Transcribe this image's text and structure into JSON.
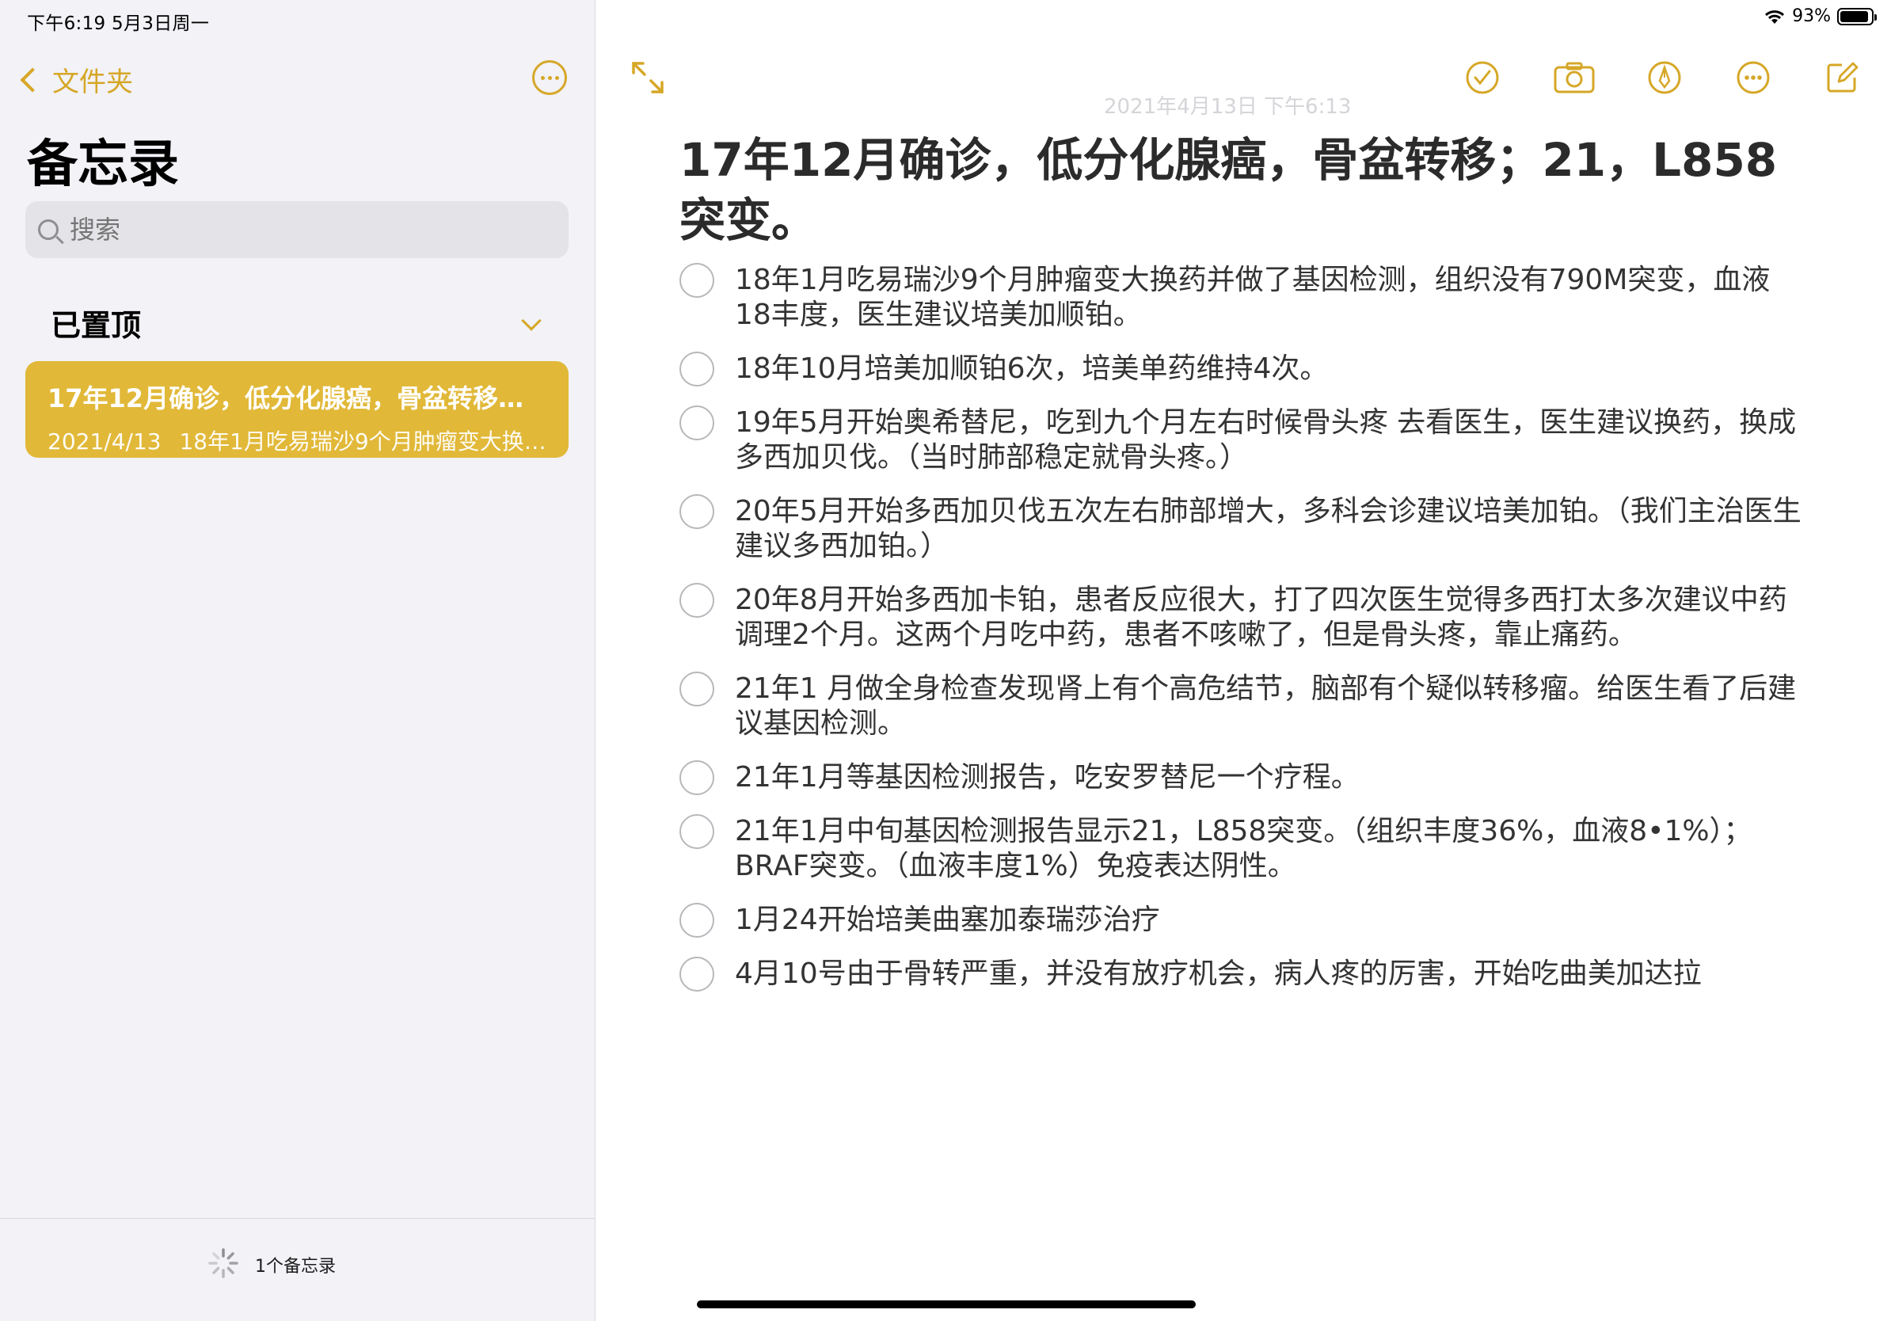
{
  "status_bar": {
    "time": "下午6:19   5月3日周一",
    "battery": "93%",
    "battery_level": 0.93
  },
  "sidebar": {
    "back_label": "文件夹",
    "title": "备忘录",
    "search_placeholder": "搜索",
    "pinned_header": "已置顶",
    "note": {
      "title": "17年12月确诊，低分化腺癌，骨盆转移；21，L858突变。",
      "date": "2021/4/13",
      "preview": "18年1月吃易瑞沙9个月肿瘤变大换药并做了基因检测，组织没有790M突变"
    },
    "footer_count": "1个备忘录"
  },
  "note": {
    "date_stamp": "2021年4月13日 下午6:13",
    "title": "17年12月确诊，低分化腺癌，骨盆转移；21，L858突变。",
    "items": [
      "18年1月吃易瑞沙9个月肿瘤变大换药并做了基因检测，组织没有790M突变，血液18丰度，医生建议培美加顺铂。",
      "18年10月培美加顺铂6次，培美单药维持4次。",
      "19年5月开始奥希替尼，吃到九个月左右时候骨头疼 去看医生，医生建议换药，换成多西加贝伐。（当时肺部稳定就骨头疼。）",
      "20年5月开始多西加贝伐五次左右肺部增大，多科会诊建议培美加铂。（我们主治医生建议多西加铂。）",
      "20年8月开始多西加卡铂，患者反应很大，打了四次医生觉得多西打太多次建议中药调理2个月。这两个月吃中药，患者不咳嗽了，但是骨头疼，靠止痛药。",
      "21年1 月做全身检查发现肾上有个高危结节，脑部有个疑似转移瘤。给医生看了后建议基因检测。",
      "21年1月等基因检测报告，吃安罗替尼一个疗程。",
      "21年1月中旬基因检测报告显示21，L858突变。（组织丰度36%，血液8•1%）；BRAF突变。（血液丰度1%）免疫表达阴性。",
      "1月24开始培美曲塞加泰瑞莎治疗",
      "4月10号由于骨转严重，并没有放疗机会，病人疼的厉害，开始吃曲美加达拉"
    ]
  },
  "colors": {
    "accent": "#d6a727",
    "card": "#e1b838",
    "sidebar_bg": "#f2f2f7"
  }
}
